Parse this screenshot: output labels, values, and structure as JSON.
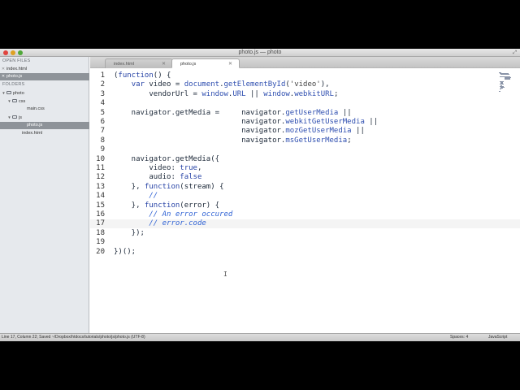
{
  "window": {
    "title": "photo.js — photo"
  },
  "sidebar": {
    "open_files_header": "OPEN FILES",
    "open_files": [
      {
        "name": "index.html",
        "selected": false
      },
      {
        "name": "photo.js",
        "selected": true
      }
    ],
    "folders_header": "FOLDERS",
    "tree": [
      {
        "name": "photo",
        "type": "folder",
        "selected": false
      },
      {
        "name": "css",
        "type": "folder",
        "selected": false
      },
      {
        "name": "main.css",
        "type": "file",
        "selected": false
      },
      {
        "name": "js",
        "type": "folder",
        "selected": false
      },
      {
        "name": "photo.js",
        "type": "file",
        "selected": true
      },
      {
        "name": "index.html",
        "type": "file",
        "selected": false
      }
    ]
  },
  "tabs": [
    {
      "label": "index.html",
      "active": false
    },
    {
      "label": "photo.js",
      "active": true
    }
  ],
  "editor": {
    "line_numbers": [
      "1",
      "2",
      "3",
      "4",
      "5",
      "6",
      "7",
      "8",
      "9",
      "10",
      "11",
      "12",
      "13",
      "14",
      "15",
      "16",
      "17",
      "18",
      "19",
      "20"
    ],
    "current_line": 17,
    "lines": [
      "(function() {",
      "    var video = document.getElementById('video'),",
      "        vendorUrl = window.URL || window.webkitURL;",
      "",
      "    navigator.getMedia =     navigator.getUserMedia ||",
      "                             navigator.webkitGetUserMedia ||",
      "                             navigator.mozGetUserMedia ||",
      "                             navigator.msGetUserMedia;",
      "",
      "    navigator.getMedia({",
      "        video: true,",
      "        audio: false",
      "    }, function(stream) {",
      "        //",
      "    }, function(error) {",
      "        // An error occured",
      "        // error.code",
      "    });",
      "",
      "})();"
    ]
  },
  "statusbar": {
    "text": "Line 17, Column 22; Saved ~/Dropbox/htdocs/tutorials/photo/js/photo.js (UTF-8)",
    "spaces": "Spaces: 4",
    "syntax": "JavaScript"
  }
}
